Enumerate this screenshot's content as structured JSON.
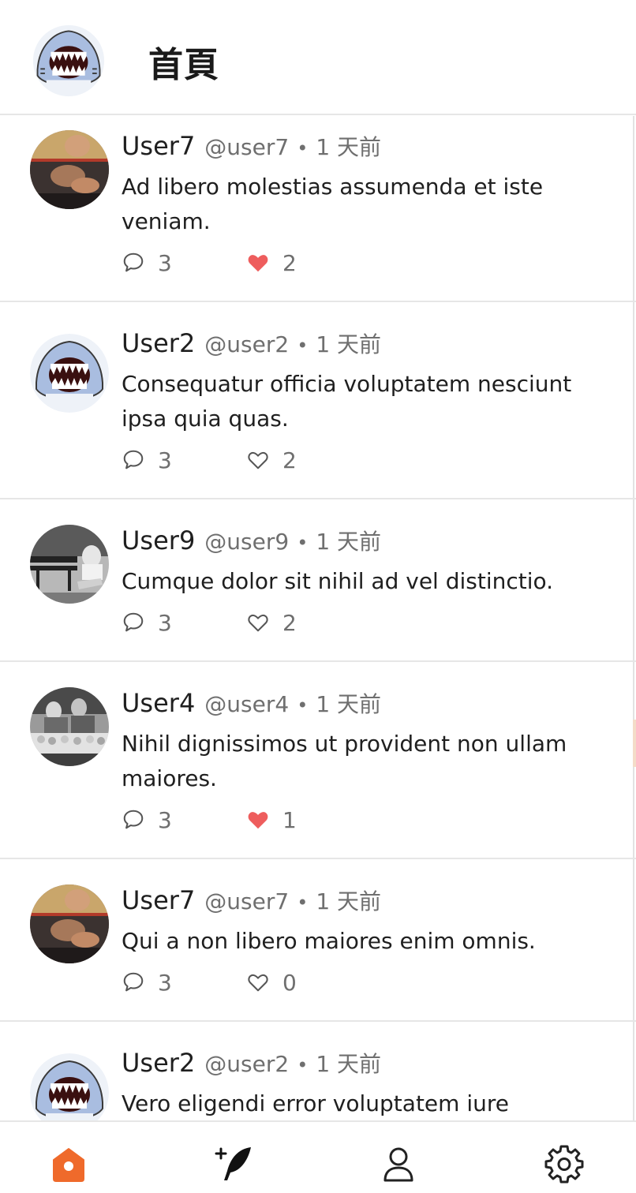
{
  "header": {
    "title": "首頁",
    "logo_icon": "shark-logo-icon"
  },
  "colors": {
    "accent": "#ef6a2b",
    "like_red": "#ee5d5d",
    "text_muted": "#6f6f6f",
    "divider": "#e6e6e6"
  },
  "posts": [
    {
      "name": "User7",
      "handle": "@user7",
      "separator": "•",
      "time": "1 天前",
      "content": "Ad libero molestias assumenda et iste veniam.",
      "replies": "3",
      "likes": "2",
      "liked": true,
      "avatar": "wrestling-photo"
    },
    {
      "name": "User2",
      "handle": "@user2",
      "separator": "•",
      "time": "1 天前",
      "content": "Consequatur officia voluptatem nesciunt ipsa quia quas.",
      "replies": "3",
      "likes": "2",
      "liked": false,
      "avatar": "shark-avatar"
    },
    {
      "name": "User9",
      "handle": "@user9",
      "separator": "•",
      "time": "1 天前",
      "content": "Cumque dolor sit nihil ad vel distinctio.",
      "replies": "3",
      "likes": "2",
      "liked": false,
      "avatar": "bench-photo"
    },
    {
      "name": "User4",
      "handle": "@user4",
      "separator": "•",
      "time": "1 天前",
      "content": "Nihil dignissimos ut provident non ullam maiores.",
      "replies": "3",
      "likes": "1",
      "liked": true,
      "avatar": "market-photo"
    },
    {
      "name": "User7",
      "handle": "@user7",
      "separator": "•",
      "time": "1 天前",
      "content": "Qui a non libero maiores enim omnis.",
      "replies": "3",
      "likes": "0",
      "liked": false,
      "avatar": "wrestling-photo"
    },
    {
      "name": "User2",
      "handle": "@user2",
      "separator": "•",
      "time": "1 天前",
      "content": "Vero eligendi error voluptatem iure",
      "replies": "",
      "likes": "",
      "liked": false,
      "avatar": "shark-avatar"
    }
  ],
  "bottom_nav": [
    {
      "name": "home",
      "icon": "home-icon",
      "active": true
    },
    {
      "name": "compose",
      "icon": "compose-feather-icon",
      "active": false
    },
    {
      "name": "profile",
      "icon": "user-icon",
      "active": false
    },
    {
      "name": "settings",
      "icon": "gear-icon",
      "active": false
    }
  ]
}
